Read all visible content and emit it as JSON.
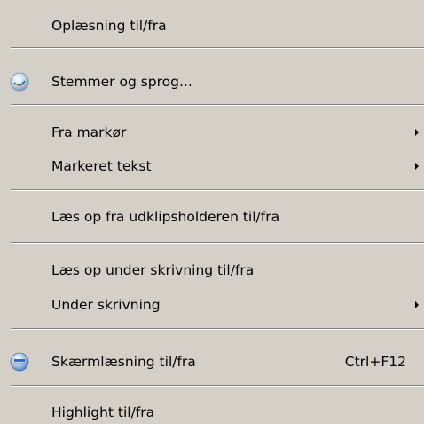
{
  "menu": {
    "items": [
      {
        "label": "Oplæsning til/fra"
      },
      {
        "label": "Stemmer og sprog...",
        "icon": "voices-globe-icon"
      },
      {
        "label": "Fra markør",
        "submenu": true
      },
      {
        "label": "Markeret tekst",
        "submenu": true
      },
      {
        "label": "Læs op fra udklipsholderen til/fra"
      },
      {
        "label": "Læs op under skrivning til/fra"
      },
      {
        "label": "Under skrivning",
        "submenu": true
      },
      {
        "label": "Skærmlæsning til/fra",
        "shortcut": "Ctrl+F12",
        "icon": "screen-reading-icon"
      },
      {
        "label": "Highlight til/fra"
      }
    ]
  },
  "colors": {
    "menu_background": "#d4d0c8",
    "separator_dark": "#808080",
    "separator_light": "#ffffff",
    "text": "#000000"
  }
}
